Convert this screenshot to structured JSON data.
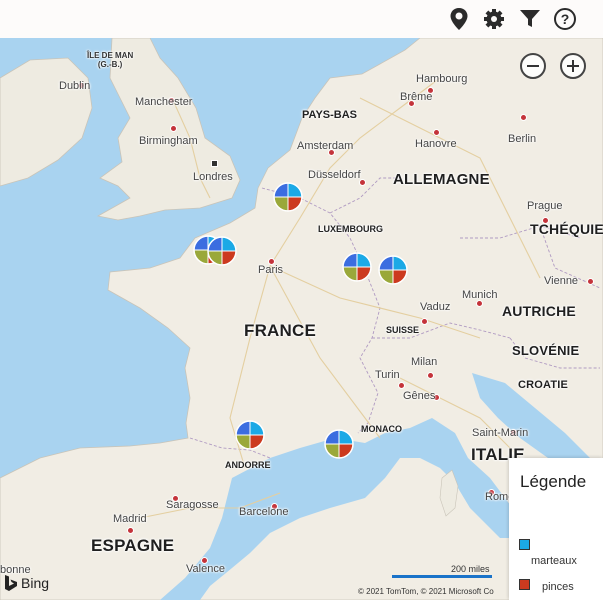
{
  "toolbar": {
    "icons": [
      "location-pin-icon",
      "gear-icon",
      "filter-icon",
      "help-icon"
    ]
  },
  "map": {
    "countries": [
      "ALLEMAGNE",
      "TCHÉQUIE",
      "AUTRICHE",
      "SLOVÉNIE",
      "CROATIE",
      "FRANCE",
      "ITALIE",
      "ESPAGNE"
    ],
    "regions": [
      "PAYS-BAS",
      "LUXEMBOURG",
      "SUISSE",
      "MONACO",
      "ANDORRE"
    ],
    "isle_of_man": "ÎLE DE MAN",
    "isle_of_man_sub": "(G.-B.)",
    "cities": [
      "Dublin",
      "Manchester",
      "Birmingham",
      "Londres",
      "Hambourg",
      "Brême",
      "Berlin",
      "Amsterdam",
      "Hanovre",
      "Düsseldorf",
      "Prague",
      "Paris",
      "Vienne",
      "Munich",
      "Vaduz",
      "Milan",
      "Turin",
      "Gênes",
      "Saint-Marin",
      "Rome",
      "Saragosse",
      "Madrid",
      "Barcelone",
      "Valence",
      "bonne"
    ],
    "colors": {
      "water": "#a9d3f0",
      "land": "#f1ede4",
      "marteaux": "#1ba9e6",
      "pinces": "#cc3a1f"
    }
  },
  "controls": {
    "zoom_out": "−",
    "zoom_in": "+"
  },
  "legend": {
    "title": "Légende",
    "items": [
      {
        "label": "marteaux",
        "color": "#1ba9e6"
      },
      {
        "label": "pinces",
        "color": "#cc3a1f"
      }
    ]
  },
  "scale": {
    "text": "200 miles"
  },
  "branding": {
    "bing": "Bing"
  },
  "copyright": "© 2021 TomTom, © 2021 Microsoft Co"
}
